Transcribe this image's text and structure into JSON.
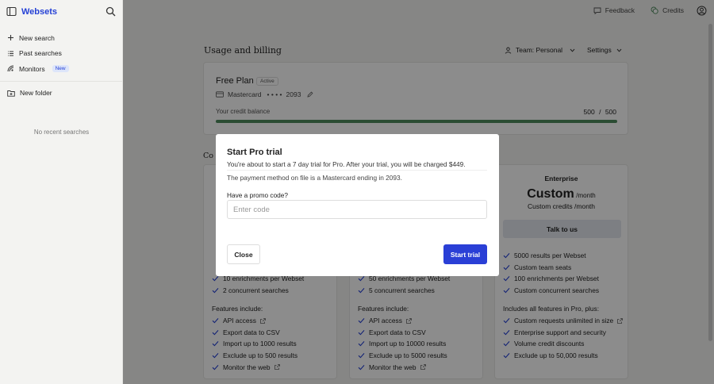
{
  "sidebar": {
    "brand": "Websets",
    "items": [
      {
        "label": "New search",
        "icon": "plus-icon"
      },
      {
        "label": "Past searches",
        "icon": "list-icon"
      },
      {
        "label": "Monitors",
        "icon": "monitor-radar-icon",
        "badge": "New"
      }
    ],
    "folder_label": "New folder",
    "empty_text": "No recent searches"
  },
  "topbar": {
    "feedback_label": "Feedback",
    "credits_label": "Credits"
  },
  "page": {
    "title": "Usage and billing",
    "team_label": "Team: Personal",
    "settings_label": "Settings"
  },
  "plan": {
    "name": "Free Plan",
    "status": "Active",
    "card_brand": "Mastercard",
    "card_mask": "• • • •",
    "card_last": "2093",
    "balance_label": "Your credit balance",
    "balance_used": "500",
    "balance_sep": "/",
    "balance_total": "500",
    "balance_fraction": 1.0
  },
  "compare": {
    "heading": "Co"
  },
  "tiers": [
    {
      "name": "",
      "price": "",
      "per": "",
      "credits": "",
      "cta": "",
      "features_top": [
        "",
        "",
        "10 enrichments per Webset",
        "2 concurrent searches"
      ],
      "features_head": "Features include:",
      "features": [
        "API access",
        "Export data to CSV",
        "Import up to 1000 results",
        "Exclude up to 500 results",
        "Monitor the web"
      ]
    },
    {
      "name": "",
      "price": "",
      "per": "",
      "credits": "",
      "cta": "",
      "features_top": [
        "",
        "",
        "50 enrichments per Webset",
        "5 concurrent searches"
      ],
      "features_head": "Features include:",
      "features": [
        "API access",
        "Export data to CSV",
        "Import up to 10000 results",
        "Exclude up to 5000 results",
        "Monitor the web"
      ]
    },
    {
      "name": "Enterprise",
      "price": "Custom",
      "per": "/month",
      "credits": "Custom credits /month",
      "cta": "Talk to us",
      "features_top": [
        "5000 results per Webset",
        "Custom team seats",
        "100 enrichments per Webset",
        "Custom concurrent searches"
      ],
      "features_head": "Includes all features in Pro, plus:",
      "features": [
        "Custom requests unlimited in size",
        "Enterprise support and security",
        "Volume credit discounts",
        "Exclude up to 50,000 results"
      ]
    }
  ],
  "modal": {
    "title": "Start Pro trial",
    "description": "You're about to start a 7 day trial for Pro. After your trial, you will be charged $449.",
    "note": "The payment method on file is a Mastercard ending in 2093.",
    "promo_label": "Have a promo code?",
    "promo_placeholder": "Enter code",
    "promo_value": "",
    "close_label": "Close",
    "start_label": "Start trial"
  },
  "colors": {
    "accent": "#2a3fd6",
    "brand": "#2541d6",
    "check": "#2541d6",
    "progress": "#4f8a5e"
  }
}
